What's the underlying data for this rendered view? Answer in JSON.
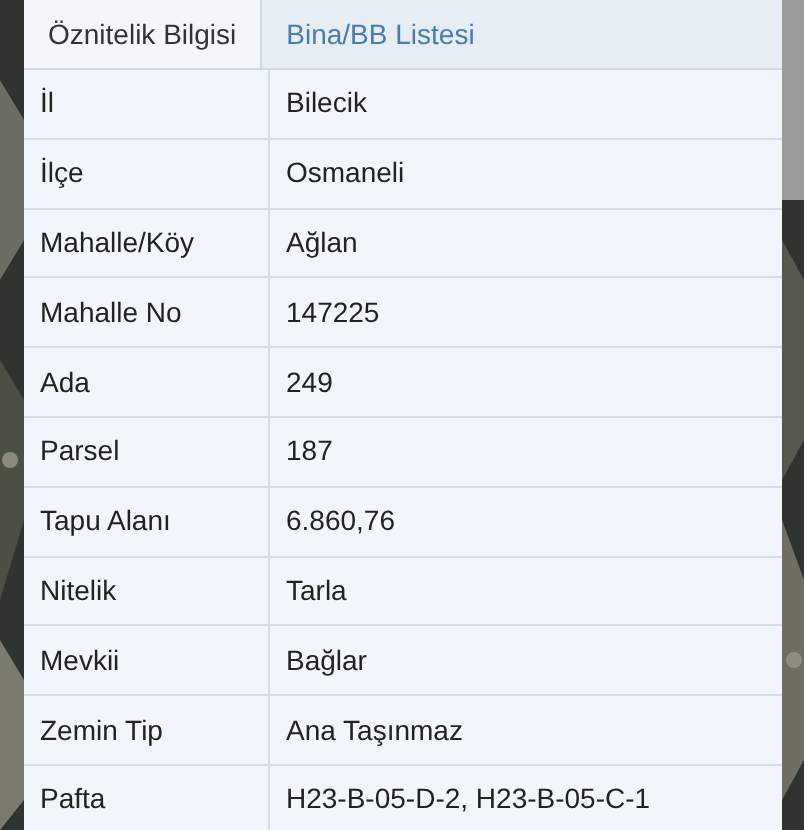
{
  "tabs": [
    {
      "label": "Öznitelik Bilgisi",
      "selected": true
    },
    {
      "label": "Bina/BB Listesi",
      "selected": false
    }
  ],
  "attributes": [
    {
      "label": "İl",
      "value": "Bilecik"
    },
    {
      "label": "İlçe",
      "value": "Osmaneli"
    },
    {
      "label": "Mahalle/Köy",
      "value": "Ağlan"
    },
    {
      "label": "Mahalle No",
      "value": "147225"
    },
    {
      "label": "Ada",
      "value": "249"
    },
    {
      "label": "Parsel",
      "value": "187"
    },
    {
      "label": "Tapu Alanı",
      "value": "6.860,76"
    },
    {
      "label": "Nitelik",
      "value": "Tarla"
    },
    {
      "label": "Mevkii",
      "value": "Bağlar"
    },
    {
      "label": "Zemin Tip",
      "value": "Ana Taşınmaz"
    },
    {
      "label": "Pafta",
      "value": "H23-B-05-D-2, H23-B-05-C-1"
    }
  ]
}
